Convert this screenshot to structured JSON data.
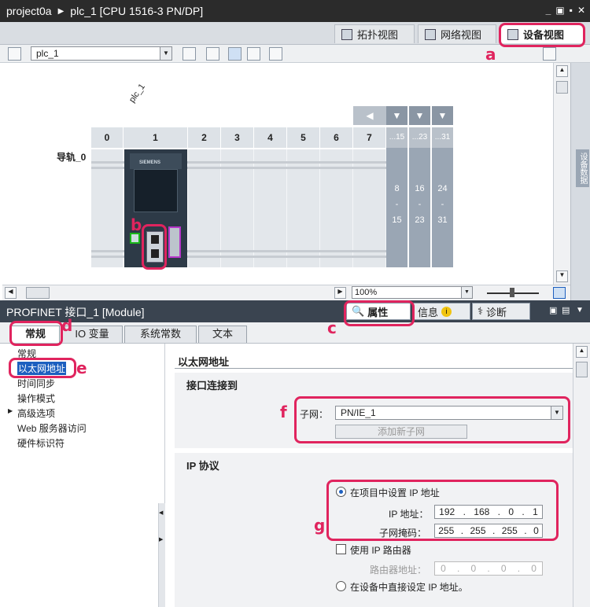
{
  "window": {
    "title_project": "project0a",
    "title_device": "plc_1 [CPU 1516-3 PN/DP]"
  },
  "view_tabs": {
    "topology": "拓扑视图",
    "network": "网络视图",
    "device": "设备视图"
  },
  "toolbar": {
    "device_select": "plc_1",
    "zoom_value": "100%"
  },
  "canvas": {
    "device_label": "plc_1",
    "rail_label": "导轨_0",
    "slots": [
      "0",
      "1",
      "2",
      "3",
      "4",
      "5",
      "6",
      "7"
    ],
    "ext_headers": [
      "...15",
      "...23",
      "...31"
    ],
    "ext_ranges": [
      {
        "from": "8",
        "dash": "-",
        "to": "15"
      },
      {
        "from": "16",
        "dash": "-",
        "to": "23"
      },
      {
        "from": "24",
        "dash": "-",
        "to": "31"
      }
    ],
    "cpu_brand": "SIEMENS",
    "side_panel": "设备数据"
  },
  "inspector": {
    "title": "PROFINET 接口_1 [Module]",
    "tabs": {
      "properties": "属性",
      "info": "信息",
      "diagnostics": "诊断"
    },
    "subtabs": [
      "常规",
      "IO 变量",
      "系统常数",
      "文本"
    ]
  },
  "nav": {
    "items": [
      "常规",
      "以太网地址",
      "时间同步",
      "操作模式",
      "高级选项",
      "Web 服务器访问",
      "硬件标识符"
    ]
  },
  "content": {
    "page_title": "以太网地址",
    "interface_section": "接口连接到",
    "subnet_label": "子网：",
    "subnet_value": "PN/IE_1",
    "add_subnet_button": "添加新子网",
    "ip_section": "IP 协议",
    "set_in_project": "在项目中设置 IP 地址",
    "ip_label": "IP 地址：",
    "ip_address": [
      "192",
      "168",
      "0",
      "1"
    ],
    "mask_label": "子网掩码：",
    "subnet_mask": [
      "255",
      "255",
      "255",
      "0"
    ],
    "use_router": "使用 IP 路由器",
    "router_label": "路由器地址：",
    "router_address": [
      "0",
      "0",
      "0",
      "0"
    ],
    "set_on_device": "在设备中直接设定 IP 地址。"
  },
  "annotations": {
    "a": "a",
    "b": "b",
    "c": "c",
    "d": "d",
    "e": "e",
    "f": "f",
    "g": "g",
    "color": "#e0245e"
  }
}
